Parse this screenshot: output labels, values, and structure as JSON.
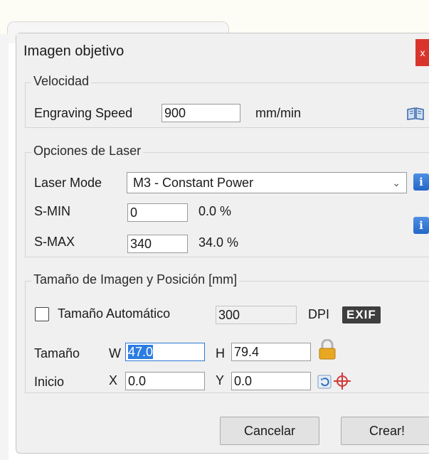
{
  "dialog": {
    "title": "Imagen objetivo",
    "close_label": "x"
  },
  "speed_group": {
    "legend": "Velocidad",
    "speed_label": "Engraving Speed",
    "speed_value": "900",
    "speed_unit": "mm/min"
  },
  "laser_group": {
    "legend": "Opciones de Laser",
    "mode_label": "Laser Mode",
    "mode_value": "M3 - Constant Power",
    "smin_label": "S-MIN",
    "smin_value": "0",
    "smin_percent": "0.0 %",
    "smax_label": "S-MAX",
    "smax_value": "340",
    "smax_percent": "34.0 %",
    "info_glyph": "i"
  },
  "size_group": {
    "legend": "Tamaño de Imagen y Posición [mm]",
    "auto_size_label": "Tamaño Automático",
    "auto_size_checked": false,
    "dpi_value": "300",
    "dpi_label": "DPI",
    "exif_label": "EXIF",
    "size_label": "Tamaño",
    "w_label": "W",
    "w_value": "47.0",
    "h_label": "H",
    "h_value": "79.4",
    "start_label": "Inicio",
    "x_label": "X",
    "x_value": "0.0",
    "y_label": "Y",
    "y_value": "0.0"
  },
  "buttons": {
    "cancel": "Cancelar",
    "create": "Crear!"
  },
  "icons": {
    "help": "book-icon",
    "info": "info-icon",
    "lock": "lock-icon",
    "reset": "reset-icon",
    "center": "crosshair-icon"
  },
  "colors": {
    "accent": "#2b7de2",
    "close": "#d9342b",
    "lock": "#e8a824",
    "crosshair": "#d23a3a"
  }
}
